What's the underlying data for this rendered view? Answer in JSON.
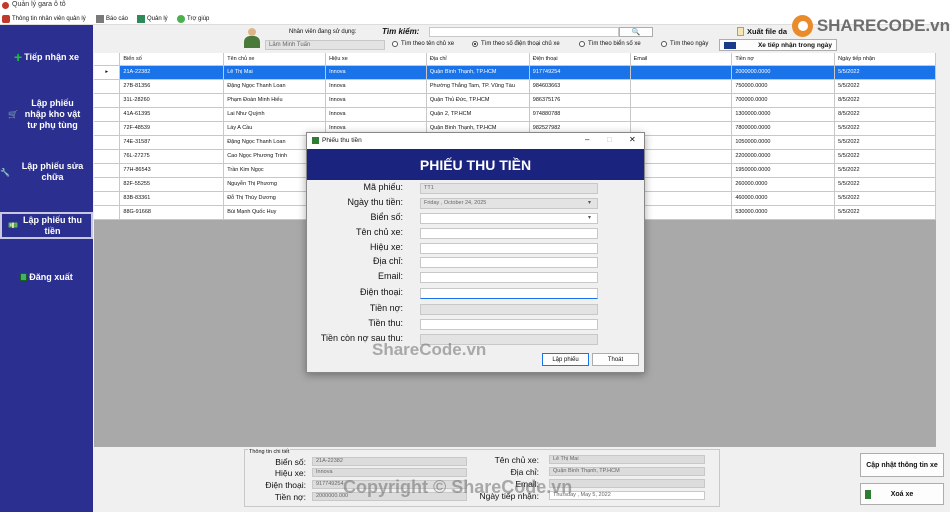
{
  "window": {
    "title": "Quản lý gara ô tô"
  },
  "menu": [
    {
      "label": "Thông tin nhân viên quản lý",
      "icon": "user-icon"
    },
    {
      "label": "Báo cáo",
      "icon": "report-icon"
    },
    {
      "label": "Quản lý",
      "icon": "manage-icon"
    },
    {
      "label": "Trợ giúp",
      "icon": "help-icon"
    }
  ],
  "sidebar": {
    "items": [
      {
        "label": "Tiếp nhận xe",
        "icon": "plus-icon"
      },
      {
        "label": "Lập phiếu nhập kho vật tư phụ tùng",
        "icon": "cart-icon"
      },
      {
        "label": "Lập phiếu sửa chữa",
        "icon": "wrench-icon"
      },
      {
        "label": "Lập phiếu thu tiền",
        "icon": "money-icon"
      },
      {
        "label": "Đăng xuất",
        "icon": "logout-icon"
      }
    ]
  },
  "topbar": {
    "employee_label": "Nhân viên đang sử dụng:",
    "employee_name": "Lâm Minh Tuấn",
    "search_label": "Tìm kiếm:",
    "radios": [
      "Tìm theo tên chủ xe",
      "Tìm theo số điện thoại chủ xe",
      "Tìm theo biển số xe",
      "Tìm theo ngày"
    ],
    "selected_radio_index": 1,
    "export_button": "Xuất file da",
    "today_button": "Xe tiếp nhận trong ngày"
  },
  "table": {
    "columns": [
      "Biển số",
      "Tên chủ xe",
      "Hiệu xe",
      "Địa chỉ",
      "Điện thoại",
      "Email",
      "Tiền nợ",
      "Ngày tiếp nhận"
    ],
    "rows": [
      [
        "21A-22382",
        "Lê Thị Mai",
        "Innova",
        "Quận Bình Thạnh, TP.HCM",
        "917749254",
        "",
        "2000000.0000",
        "5/5/2022"
      ],
      [
        "27B-81356",
        "Đặng Ngọc Thanh Loan",
        "Innova",
        "Phường Thắng Tam, TP. Vũng Tàu",
        "984603663",
        "",
        "750000.0000",
        "5/5/2022"
      ],
      [
        "31L-28260",
        "Phạm Đoàn Minh Hiếu",
        "Innova",
        "Quận Thủ Đức, TP.HCM",
        "986375176",
        "",
        "700000.0000",
        "8/5/2022"
      ],
      [
        "41A-61395",
        "Lai Như Quỳnh",
        "Innova",
        "Quận 2, TP.HCM",
        "974880788",
        "",
        "1300000.0000",
        "8/5/2022"
      ],
      [
        "72F-48539",
        "Láy A Cầu",
        "Innova",
        "Quận Bình Thạnh, TP.HCM",
        "982527982",
        "",
        "7800000.0000",
        "5/5/2022"
      ],
      [
        "74E-31587",
        "Đặng Ngọc Thanh Loan",
        "",
        "",
        "",
        "",
        "1050000.0000",
        "5/5/2022"
      ],
      [
        "76L-27275",
        "Cao Ngọc Phương Trinh",
        "",
        "",
        "",
        "",
        "2200000.0000",
        "5/5/2022"
      ],
      [
        "77H-86543",
        "Trần Kim Ngọc",
        "",
        "",
        "",
        "",
        "1950000.0000",
        "5/5/2022"
      ],
      [
        "82F-55255",
        "Nguyễn Thị Phương",
        "",
        "",
        "",
        "",
        "260000.0000",
        "5/5/2022"
      ],
      [
        "83B-83361",
        "Đỗ Thị Thùy Dương",
        "",
        "",
        "",
        "",
        "460000.0000",
        "5/5/2022"
      ],
      [
        "88G-91668",
        "Bùi Mạnh Quốc Huy",
        "",
        "",
        "",
        "",
        "530000.0000",
        "5/5/2022"
      ]
    ]
  },
  "dialog": {
    "window_title": "Phiếu thu tiền",
    "header": "PHIẾU THU TIỀN",
    "fields": [
      {
        "label": "Mã phiếu:",
        "value": "TT1"
      },
      {
        "label": "Ngày thu tiền:",
        "value": "Friday   ,  October   24, 2025"
      },
      {
        "label": "Biển số:",
        "value": ""
      },
      {
        "label": "Tên chủ xe:",
        "value": ""
      },
      {
        "label": "Hiệu xe:",
        "value": ""
      },
      {
        "label": "Địa chỉ:",
        "value": ""
      },
      {
        "label": "Email:",
        "value": ""
      },
      {
        "label": "Điện thoại:",
        "value": ""
      },
      {
        "label": "Tiền nợ:",
        "value": ""
      },
      {
        "label": "Tiền thu:",
        "value": ""
      },
      {
        "label": "Tiền còn nợ sau thu:",
        "value": ""
      }
    ],
    "submit_button": "Lập phiếu",
    "exit_button": "Thoát"
  },
  "detail": {
    "group_title": "Thông tin chi tiết",
    "left": [
      {
        "label": "Biển số:",
        "value": "21A-22382"
      },
      {
        "label": "Hiệu xe:",
        "value": "Innova"
      },
      {
        "label": "Điện thoại:",
        "value": "917749254"
      },
      {
        "label": "Tiền nợ:",
        "value": "2000000.000"
      }
    ],
    "right": [
      {
        "label": "Tên chủ xe:",
        "value": "Lê Thị Mai"
      },
      {
        "label": "Địa chỉ:",
        "value": "Quận Bình Thạnh, TP.HCM"
      },
      {
        "label": "Email:",
        "value": ""
      },
      {
        "label": "Ngày tiếp nhận:",
        "value": "Thursday   ,    May       5, 2022"
      }
    ],
    "update_button": "Cập nhật thông tin xe",
    "delete_button": "Xoá xe"
  },
  "watermark": {
    "logo_text": "SHARECODE.vn",
    "center_text": "ShareCode.vn",
    "bottom_text": "Copyright © ShareCode.vn"
  }
}
